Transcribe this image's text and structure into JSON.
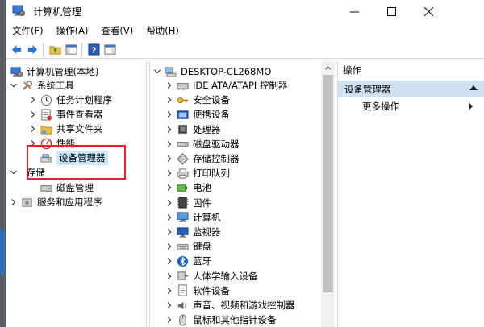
{
  "window": {
    "title": "计算机管理"
  },
  "menubar": [
    {
      "label": "文件(F)"
    },
    {
      "label": "操作(A)"
    },
    {
      "label": "查看(V)"
    },
    {
      "label": "帮助(H)"
    }
  ],
  "left_tree": {
    "root": "计算机管理(本地)",
    "system_tools": "系统工具",
    "items": [
      {
        "label": "任务计划程序",
        "icon": "clock-icon"
      },
      {
        "label": "事件查看器",
        "icon": "event-viewer-icon"
      },
      {
        "label": "共享文件夹",
        "icon": "shared-folder-icon"
      },
      {
        "label": "性能",
        "icon": "performance-icon"
      },
      {
        "label": "设备管理器",
        "icon": "device-manager-icon"
      }
    ],
    "storage": "存储",
    "disk_management": "磁盘管理",
    "services": "服务和应用程序"
  },
  "device_tree": {
    "root": "DESKTOP-CL268MO",
    "categories": [
      {
        "label": "IDE ATA/ATAPI 控制器",
        "icon": "ide-controller-icon"
      },
      {
        "label": "安全设备",
        "icon": "security-device-icon"
      },
      {
        "label": "便携设备",
        "icon": "portable-device-icon"
      },
      {
        "label": "处理器",
        "icon": "processor-icon"
      },
      {
        "label": "磁盘驱动器",
        "icon": "disk-drive-icon"
      },
      {
        "label": "存储控制器",
        "icon": "storage-controller-icon"
      },
      {
        "label": "打印队列",
        "icon": "printer-icon"
      },
      {
        "label": "电池",
        "icon": "battery-icon"
      },
      {
        "label": "固件",
        "icon": "firmware-icon"
      },
      {
        "label": "计算机",
        "icon": "computer-icon"
      },
      {
        "label": "监视器",
        "icon": "monitor-icon"
      },
      {
        "label": "键盘",
        "icon": "keyboard-icon"
      },
      {
        "label": "蓝牙",
        "icon": "bluetooth-icon"
      },
      {
        "label": "人体学输入设备",
        "icon": "hid-icon"
      },
      {
        "label": "软件设备",
        "icon": "software-device-icon"
      },
      {
        "label": "声音、视频和游戏控制器",
        "icon": "sound-icon"
      },
      {
        "label": "鼠标和其他指针设备",
        "icon": "mouse-icon"
      }
    ]
  },
  "actions": {
    "header": "操作",
    "section_title": "设备管理器",
    "more": "更多操作"
  },
  "colors": {
    "highlight": "#e8202a",
    "selection": "#cce8ff",
    "actions_header": "#cfe0f0"
  }
}
